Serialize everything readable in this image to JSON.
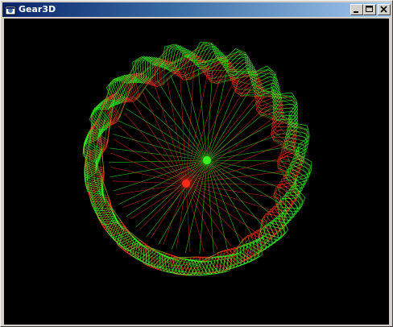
{
  "window": {
    "title": "Gear3D",
    "app_icon": "gear-app-icon",
    "buttons": {
      "minimize": "minimize-icon",
      "maximize": "maximize-icon",
      "close": "close-icon"
    }
  },
  "colors": {
    "titlebar_start": "#0a246a",
    "titlebar_end": "#a6caf0",
    "viewport_background": "#000000",
    "front_mesh": "#33ff22",
    "back_mesh": "#ff2a1a"
  },
  "scene": {
    "object": "bevel-gear-wireframe",
    "tooth_count": 20
  }
}
